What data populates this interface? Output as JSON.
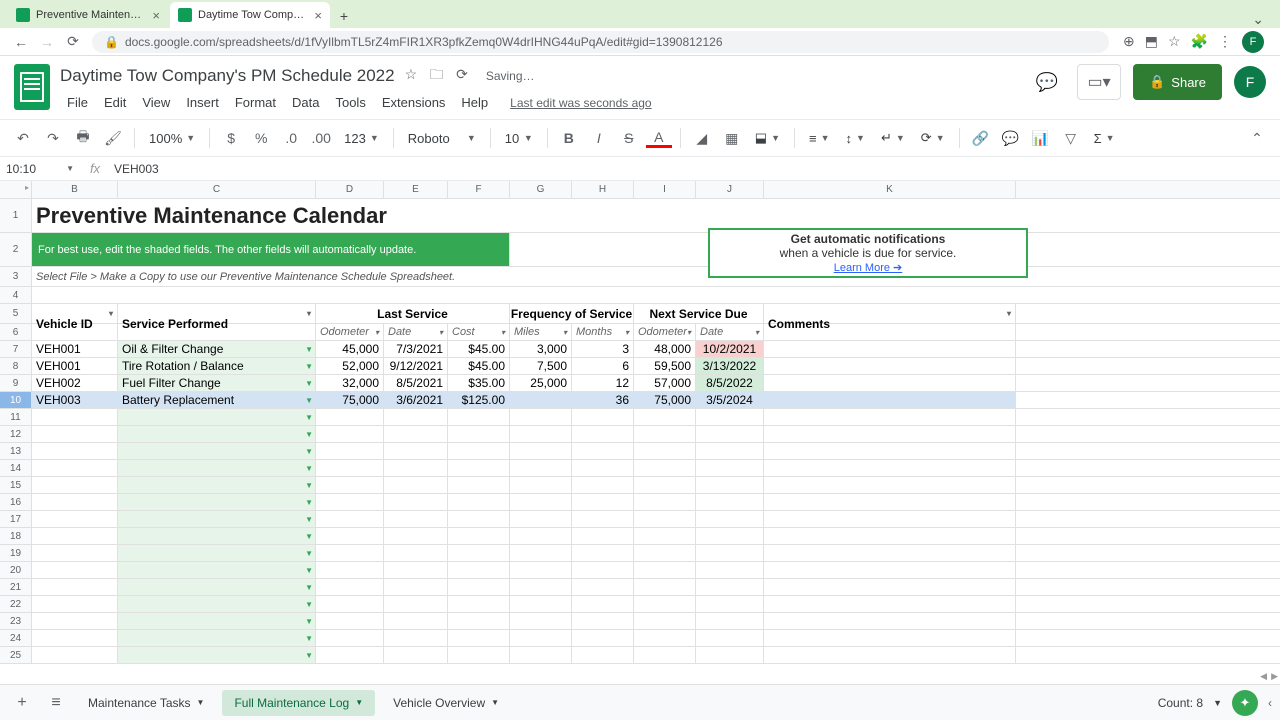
{
  "browser": {
    "tab1": "Preventive Maintenance Sche",
    "tab2": "Daytime Tow Company's PM S",
    "url": "docs.google.com/spreadsheets/d/1fVyIlbmTL5rZ4mFIR1XR3pfkZemq0W4drIHNG44uPqA/edit#gid=1390812126",
    "avatar": "F"
  },
  "doc": {
    "title": "Daytime Tow Company's PM Schedule 2022",
    "saving": "Saving…",
    "last_edit": "Last edit was seconds ago",
    "share": "Share",
    "avatar": "F"
  },
  "menu": {
    "file": "File",
    "edit": "Edit",
    "view": "View",
    "insert": "Insert",
    "format": "Format",
    "data": "Data",
    "tools": "Tools",
    "extensions": "Extensions",
    "help": "Help"
  },
  "toolbar": {
    "zoom": "100%",
    "font": "Roboto",
    "size": "10",
    "fmt": "123"
  },
  "fx": {
    "ref": "10:10",
    "val": "VEH003"
  },
  "cols": {
    "B": "B",
    "C": "C",
    "D": "D",
    "E": "E",
    "F": "F",
    "G": "G",
    "H": "H",
    "I": "I",
    "J": "J",
    "K": "K"
  },
  "sheet": {
    "title": "Preventive Maintenance Calendar",
    "hint": "For best use, edit the shaded fields. The other fields will automatically update.",
    "copy_note": "Select File > Make a Copy to use our Preventive Maintenance Schedule Spreadsheet.",
    "notif_l1": "Get automatic notifications",
    "notif_l2": "when a vehicle is due for service.",
    "notif_l3": "Learn More ➔",
    "h_vehicle": "Vehicle ID",
    "h_service": "Service Performed",
    "h_last": "Last Service",
    "h_freq": "Frequency of Service",
    "h_next": "Next Service Due",
    "h_comments": "Comments",
    "sh_odo": "Odometer",
    "sh_date": "Date",
    "sh_cost": "Cost",
    "sh_miles": "Miles",
    "sh_months": "Months",
    "sh_odo2": "Odometer",
    "sh_date2": "Date"
  },
  "rows": [
    {
      "id": "VEH001",
      "svc": "Oil & Filter Change",
      "odo": "45,000",
      "date": "7/3/2021",
      "cost": "$45.00",
      "miles": "3,000",
      "months": "3",
      "nodo": "48,000",
      "ndate": "10/2/2021",
      "due": "red"
    },
    {
      "id": "VEH001",
      "svc": "Tire Rotation / Balance",
      "odo": "52,000",
      "date": "9/12/2021",
      "cost": "$45.00",
      "miles": "7,500",
      "months": "6",
      "nodo": "59,500",
      "ndate": "3/13/2022",
      "due": "grn"
    },
    {
      "id": "VEH002",
      "svc": "Fuel Filter Change",
      "odo": "32,000",
      "date": "8/5/2021",
      "cost": "$35.00",
      "miles": "25,000",
      "months": "12",
      "nodo": "57,000",
      "ndate": "8/5/2022",
      "due": "grn"
    },
    {
      "id": "VEH003",
      "svc": "Battery Replacement",
      "odo": "75,000",
      "date": "3/6/2021",
      "cost": "$125.00",
      "miles": "",
      "months": "36",
      "nodo": "75,000",
      "ndate": "3/5/2024",
      "due": "grn"
    }
  ],
  "tabs": {
    "t1": "Maintenance Tasks",
    "t2": "Full Maintenance Log",
    "t3": "Vehicle Overview"
  },
  "footer": {
    "count": "Count: 8"
  }
}
